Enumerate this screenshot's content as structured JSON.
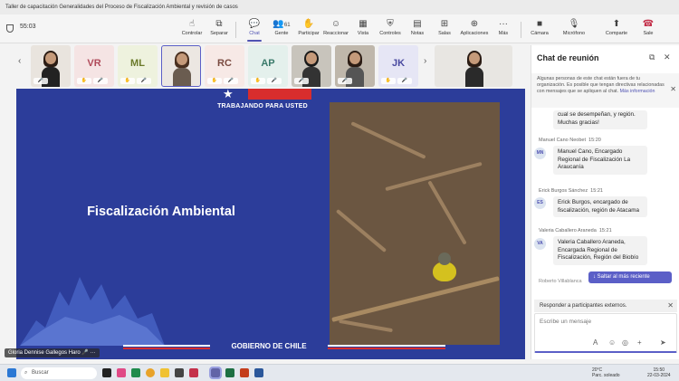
{
  "window": {
    "title": "Taller de capacitación Generalidades del Proceso de Fiscalización Ambiental y revisión de casos"
  },
  "meeting": {
    "timer": "55:03"
  },
  "toolbar": {
    "controlar": "Controlar",
    "separar": "Separar",
    "chat": "Chat",
    "gente": "Gente",
    "gente_count": "61",
    "participar": "Participar",
    "reaccionar": "Reaccionar",
    "vista": "Vista",
    "controles": "Controles",
    "notas": "Notas",
    "salas": "Salas",
    "aplicaciones": "Aplicaciones",
    "mas": "Más",
    "camara": "Cámara",
    "microfono": "Micrófono",
    "compartir": "Comparte",
    "salir": "Sale"
  },
  "participants": [
    {
      "initials": ""
    },
    {
      "initials": "VR"
    },
    {
      "initials": "ML"
    },
    {
      "initials": ""
    },
    {
      "initials": "RC"
    },
    {
      "initials": "AP"
    },
    {
      "initials": ""
    },
    {
      "initials": ""
    },
    {
      "initials": "JK"
    },
    {
      "initials": ""
    }
  ],
  "slide": {
    "slogan": "TRABAJANDO PARA USTED",
    "title": "Fiscalización Ambiental",
    "footer": "GOBIERNO DE CHILE"
  },
  "presenter": {
    "name": "Gloria Dennise Gallegos Haro"
  },
  "chat": {
    "title": "Chat de reunión",
    "notice": "Algunas personas de este chat están fuera de tu organización. Es posible que tengan directivas relacionadas con mensajes que se apliquen al chat.",
    "notice_link": "Más información",
    "first_message": "cual se desempeñan, y región. Muchas gracias!",
    "messages": [
      {
        "avatar": "MN",
        "author": "Manuel Cano Neobet",
        "time": "15:20",
        "text": "Manuel Cano, Encargado Regional de Fiscalización La Araucanía"
      },
      {
        "avatar": "ES",
        "author": "Erick Burgos Sánchez",
        "time": "15:21",
        "text": "Erick Burgos, encargado de fiscalización, región de Atacama"
      },
      {
        "avatar": "VA",
        "author": "Valeria Caballero Araneda",
        "time": "15:21",
        "text": "Valeria Caballero Araneda, Encargada Regional de Fiscalización, Región del Biobío"
      }
    ],
    "partial_author": "Roberto Villablanca",
    "jump_label": "Saltar al más reciente",
    "reply_label": "Responder a participantes externos.",
    "compose_placeholder": "Escribe un mensaje"
  },
  "taskbar": {
    "search": "Buscar",
    "temp": "20°C",
    "weather": "Parc. soleado",
    "time": "15:50",
    "date": "22-03-2024"
  },
  "colors": {
    "accent": "#5b5fc7",
    "slide_blue": "#2c3d9a",
    "flag_red": "#d82d2d",
    "leave": "#c4314b"
  }
}
